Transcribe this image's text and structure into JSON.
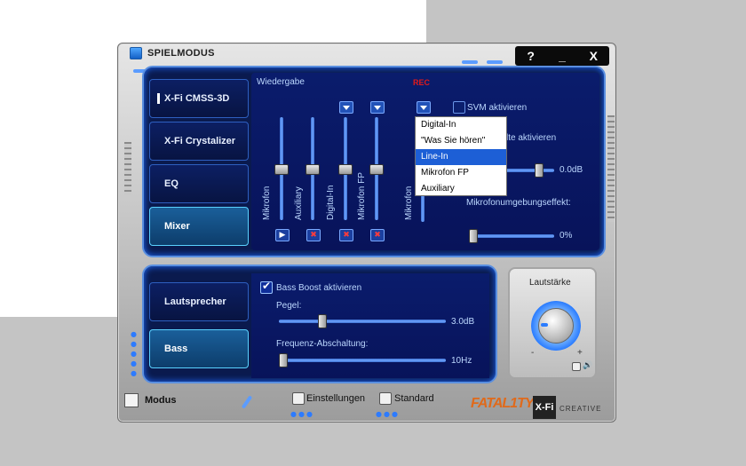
{
  "window": {
    "title": "SPIELMODUS"
  },
  "controls": {
    "help": "?",
    "minimize": "_",
    "close": "X"
  },
  "tabs_top": [
    {
      "label": "X-Fi CMSS-3D"
    },
    {
      "label": "X-Fi Crystalizer"
    },
    {
      "label": "EQ"
    },
    {
      "label": "Mixer"
    }
  ],
  "tabs_bottom": [
    {
      "label": "Lautsprecher"
    },
    {
      "label": "Bass"
    }
  ],
  "mixer": {
    "wiedergabe": "Wiedergabe",
    "rec": "REC",
    "svm_label": "SVM aktivieren",
    "partial_label": "lte aktivieren",
    "channels": [
      {
        "name": "Mikrofon",
        "level": 0.5,
        "muted": false
      },
      {
        "name": "Auxiliary",
        "level": 0.5,
        "muted": true
      },
      {
        "name": "Digital-In",
        "level": 0.5,
        "muted": true
      },
      {
        "name": "Mikrofon FP",
        "level": 0.5,
        "muted": true
      }
    ],
    "rec_channel": "Mikrofon",
    "rec_value": "0.0dB",
    "ambient_label": "Mikrofonumgebungseffekt:",
    "ambient_value": "0%"
  },
  "rec_dropdown": {
    "options": [
      "Digital-In",
      "\"Was Sie hören\"",
      "Line-In",
      "Mikrofon FP",
      "Auxiliary"
    ],
    "selected": "Line-In"
  },
  "bass": {
    "boost_label": "Bass Boost aktivieren",
    "boost_checked": true,
    "pegel_label": "Pegel:",
    "pegel_value": "3.0dB",
    "freq_label": "Frequenz-Abschaltung:",
    "freq_value": "10Hz"
  },
  "volume": {
    "title": "Lautstärke",
    "min": "-",
    "max": "+"
  },
  "footer": {
    "modus": "Modus",
    "einstellungen": "Einstellungen",
    "standard": "Standard",
    "logo": "FATAL1TY",
    "xfi": "X-Fi",
    "creative": "CREATIVE"
  },
  "colors": {
    "accent": "#1d5fd6",
    "panel": "#0a1a4e",
    "glow": "#5ad2ff"
  }
}
